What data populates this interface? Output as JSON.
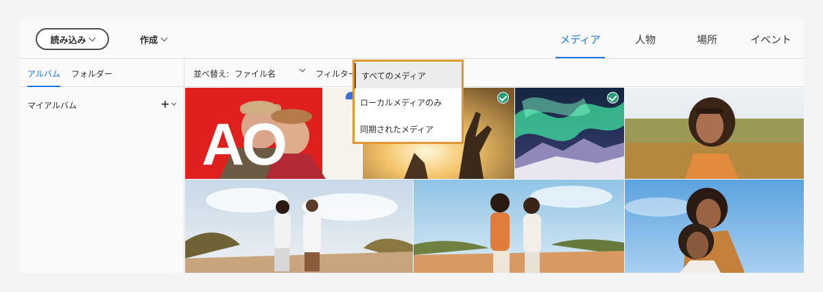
{
  "header": {
    "import_label": "読み込み",
    "create_label": "作成",
    "view_tabs": [
      {
        "label": "メディア",
        "active": true
      },
      {
        "label": "人物",
        "active": false
      },
      {
        "label": "場所",
        "active": false
      },
      {
        "label": "イベント",
        "active": false
      }
    ]
  },
  "sidebar": {
    "tabs": [
      {
        "label": "アルバム",
        "active": true
      },
      {
        "label": "フォルダー",
        "active": false
      }
    ],
    "my_albums_label": "マイアルバム",
    "add_symbol": "+"
  },
  "toolbar": {
    "sort_label": "並べ替え:",
    "sort_value": "ファイル名",
    "filter_label": "フィルター:"
  },
  "filter_dropdown": {
    "options": [
      "すべてのメディア",
      "ローカルメディアのみ",
      "同期されたメディア"
    ],
    "selected_index": 0
  },
  "grid": {
    "photo1_text": "AO",
    "photos": [
      {
        "subject": "elderly couple smiling in front of red sign",
        "status": "cloud-icon"
      },
      {
        "subject": "hand silhouette against sunset",
        "status": "check-icon"
      },
      {
        "subject": "aurora over snowy mountains",
        "status": "check-icon"
      },
      {
        "subject": "smiling woman in field",
        "status": "none"
      },
      {
        "subject": "couple walking on dirt road",
        "status": "none"
      },
      {
        "subject": "two women walking under blue sky",
        "status": "none"
      },
      {
        "subject": "two women piggyback under blue sky",
        "status": "none"
      }
    ]
  },
  "colors": {
    "accent": "#1473e6",
    "highlight_border": "#e3952f",
    "sync_check": "#2d9d78"
  }
}
